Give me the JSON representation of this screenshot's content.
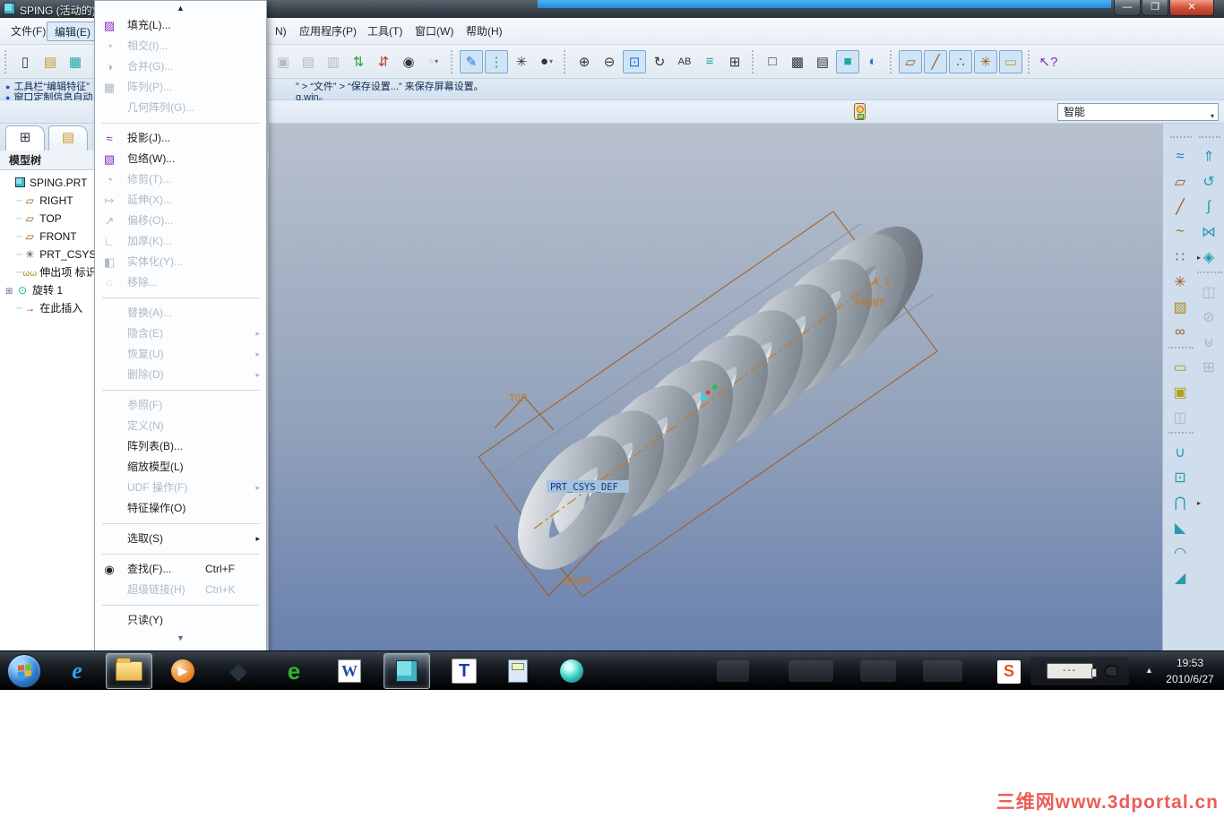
{
  "window": {
    "title": "SPING (活动的)"
  },
  "menu_bar": {
    "items": [
      "文件(F)",
      "编辑(E)",
      "N)",
      "应用程序(P)",
      "工具(T)",
      "窗口(W)",
      "帮助(H)"
    ]
  },
  "toolbar": {
    "buttons": [
      {
        "name": "new",
        "glyph": "▯"
      },
      {
        "name": "open",
        "glyph": "▤"
      },
      {
        "name": "save",
        "glyph": "▦"
      },
      {
        "name": "copy",
        "glyph": "▣",
        "disabled": true
      },
      {
        "name": "paste",
        "glyph": "▤",
        "disabled": true
      },
      {
        "name": "paste-special",
        "glyph": "▥",
        "disabled": true
      },
      {
        "name": "regenerate",
        "glyph": "⇅"
      },
      {
        "name": "regenerate-custom",
        "glyph": "⇵"
      },
      {
        "name": "find",
        "glyph": "◉"
      },
      {
        "name": "select-box",
        "glyph": "▫",
        "disabled": true,
        "dropdown": "▾"
      },
      {
        "name": "sketch-display",
        "glyph": "✎",
        "pressed": true
      },
      {
        "name": "tree-graph",
        "glyph": "⋮",
        "pressed": true
      },
      {
        "name": "view-options",
        "glyph": "✳"
      },
      {
        "name": "render-style",
        "glyph": "●",
        "dropdown": "▾"
      },
      {
        "name": "zoom-in",
        "glyph": "⊕"
      },
      {
        "name": "zoom-out",
        "glyph": "⊖"
      },
      {
        "name": "refit",
        "glyph": "⊡",
        "pressed": true
      },
      {
        "name": "reorient",
        "glyph": "↻"
      },
      {
        "name": "saved-views",
        "glyph": "AB"
      },
      {
        "name": "layers",
        "glyph": "≡"
      },
      {
        "name": "view-manager",
        "glyph": "⊞"
      },
      {
        "name": "wireframe",
        "glyph": "□"
      },
      {
        "name": "hidden-line",
        "glyph": "▩"
      },
      {
        "name": "no-hidden",
        "glyph": "▤"
      },
      {
        "name": "shaded",
        "glyph": "■",
        "pressed": true
      },
      {
        "name": "enhanced-realism",
        "glyph": "◐"
      },
      {
        "name": "plane-display",
        "glyph": "▱",
        "pressed": true
      },
      {
        "name": "axis-display",
        "glyph": "╱",
        "pressed": true
      },
      {
        "name": "point-display",
        "glyph": "∴",
        "pressed": true
      },
      {
        "name": "csys-display",
        "glyph": "✳",
        "pressed": true
      },
      {
        "name": "annotation-display",
        "glyph": "▭",
        "pressed": true
      },
      {
        "name": "context-help",
        "glyph": "↖?"
      }
    ]
  },
  "messages": {
    "line1_left": "工具栏“编辑特征”",
    "line1_right": "” > “文件” > “保存设置...” 来保存屏幕设置。",
    "line2_left": "窗口定制信息自动",
    "line2_right": "g.win。"
  },
  "filter_bar": {
    "selected": "智能",
    "arrow": "▾"
  },
  "edit_menu": {
    "scroll_up": "▲",
    "scroll_down": "▼",
    "items": [
      {
        "label": "填充(L)...",
        "glyph": "▨",
        "enabled": true
      },
      {
        "label": "相交(I)...",
        "glyph": "◔",
        "enabled": false
      },
      {
        "label": "合并(G)...",
        "glyph": "◑",
        "enabled": false
      },
      {
        "label": "阵列(P)...",
        "glyph": "▦",
        "enabled": false
      },
      {
        "label": "几何阵列(G)...",
        "enabled": false
      },
      {
        "label": "投影(J)...",
        "glyph": "≈",
        "enabled": true
      },
      {
        "label": "包络(W)...",
        "glyph": "▧",
        "enabled": true
      },
      {
        "label": "修剪(T)...",
        "glyph": "◔",
        "enabled": false
      },
      {
        "label": "延伸(X)...",
        "glyph": "↦",
        "enabled": false
      },
      {
        "label": "偏移(O)...",
        "glyph": "↗",
        "enabled": false
      },
      {
        "label": "加厚(K)...",
        "glyph": "∟",
        "enabled": false
      },
      {
        "label": "实体化(Y)...",
        "glyph": "◧",
        "enabled": false
      },
      {
        "label": "移除...",
        "glyph": "◌",
        "enabled": false
      },
      {
        "label": "替换(A)...",
        "enabled": false
      },
      {
        "label": "隐含(E)",
        "enabled": false,
        "arrow": "▸"
      },
      {
        "label": "恢复(U)",
        "enabled": false,
        "arrow": "▸"
      },
      {
        "label": "删除(D)",
        "enabled": false,
        "arrow": "▸"
      },
      {
        "label": "参照(F)",
        "enabled": false
      },
      {
        "label": "定义(N)",
        "enabled": false
      },
      {
        "label": "阵列表(B)...",
        "enabled": true
      },
      {
        "label": "缩放模型(L)",
        "enabled": true
      },
      {
        "label": "UDF 操作(F)",
        "enabled": false,
        "arrow": "▸"
      },
      {
        "label": "特征操作(O)",
        "enabled": true
      },
      {
        "label": "选取(S)",
        "enabled": true,
        "arrow": "▸"
      },
      {
        "label": "查找(F)...",
        "glyph": "◉",
        "shortcut": "Ctrl+F",
        "enabled": true
      },
      {
        "label": "超级链接(H)",
        "shortcut": "Ctrl+K",
        "enabled": false
      },
      {
        "label": "只读(Y)",
        "enabled": true
      }
    ]
  },
  "model_tree": {
    "tab1_icon": "⊞",
    "tab2_icon": "▤",
    "title": "模型树",
    "items": [
      {
        "label": "SPING.PRT",
        "icon": "part"
      },
      {
        "label": "RIGHT",
        "icon": "plane",
        "glyph": "▱"
      },
      {
        "label": "TOP",
        "icon": "plane",
        "glyph": "▱"
      },
      {
        "label": "FRONT",
        "icon": "plane",
        "glyph": "▱"
      },
      {
        "label": "PRT_CSYS_DEF",
        "icon": "csys",
        "glyph": "✳"
      },
      {
        "label": "伸出项 标识",
        "icon": "helical-sweep",
        "glyph": "ωω"
      },
      {
        "label": "旋转 1",
        "icon": "revolve",
        "glyph": "⊙",
        "expander": "⊞"
      },
      {
        "label": "在此插入",
        "icon": "insert-here",
        "glyph": "→"
      }
    ]
  },
  "graphics": {
    "labels": {
      "top": "TOP",
      "front": "FRONT",
      "axis": "A_1",
      "right": "RIGHT",
      "csys": "PRT_CSYS_DEF"
    }
  },
  "right_toolbar": {
    "col1": [
      {
        "name": "style-curve",
        "glyph": "≈",
        "color": "#2a6fc9"
      },
      {
        "name": "datum-plane",
        "glyph": "▱",
        "color": "#9a5a1e"
      },
      {
        "name": "datum-axis",
        "glyph": "╱",
        "color": "#9a5a1e"
      },
      {
        "name": "datum-curve",
        "glyph": "~",
        "color": "#9a5a1e"
      },
      {
        "name": "datum-point",
        "glyph": "∷",
        "color": "#9a5a1e",
        "fly": "▸"
      },
      {
        "name": "datum-csys",
        "glyph": "✳",
        "color": "#9a5a1e"
      },
      {
        "name": "offset-points",
        "glyph": "▨",
        "color": "#b08a20"
      },
      {
        "name": "link",
        "glyph": "∞",
        "color": "#9a5a1e"
      },
      {
        "sep": true
      },
      {
        "name": "annotation",
        "glyph": "▭",
        "color": "#b0a020"
      },
      {
        "name": "annotation-feature",
        "glyph": "▣",
        "color": "#b0a020"
      },
      {
        "name": "grouped-annotation",
        "glyph": "◫",
        "disabled": true
      },
      {
        "sep": true
      },
      {
        "name": "hole",
        "glyph": "∪",
        "color": "#2a9ab0"
      },
      {
        "name": "shell",
        "glyph": "⊡",
        "color": "#2a9ab0"
      },
      {
        "name": "rib",
        "glyph": "⋂",
        "color": "#2a9ab0",
        "fly": "▸"
      },
      {
        "name": "draft",
        "glyph": "◣",
        "color": "#2a9ab0"
      },
      {
        "name": "round",
        "glyph": "◠",
        "color": "#2a9ab0"
      },
      {
        "name": "chamfer",
        "glyph": "◢",
        "color": "#2a9ab0"
      }
    ],
    "col2": [
      {
        "name": "extrude",
        "glyph": "⇑",
        "color": "#2a9ab0"
      },
      {
        "name": "revolve",
        "glyph": "↺",
        "color": "#2a9ab0"
      },
      {
        "name": "sweep",
        "glyph": "∫",
        "color": "#2a9ab0"
      },
      {
        "name": "blend",
        "glyph": "⋈",
        "color": "#2a9ab0"
      },
      {
        "name": "boundary-blend",
        "glyph": "◈",
        "color": "#2a9ab0"
      },
      {
        "sep": true
      },
      {
        "name": "mirror",
        "glyph": "◫",
        "disabled": true
      },
      {
        "name": "trim",
        "glyph": "⊘",
        "disabled": true
      },
      {
        "name": "merge",
        "glyph": "⊎",
        "disabled": true
      },
      {
        "name": "pattern",
        "glyph": "⊞",
        "disabled": true
      }
    ]
  },
  "taskbar": {
    "time": "19:53",
    "date": "2010/6/27",
    "battery_text": "---",
    "icons": {
      "ie": "e",
      "wmp": "▶",
      "laptop": "◆",
      "browser360": "e",
      "word": "W",
      "pccad": "T",
      "tray_arrow": "▲",
      "sogou": "S"
    }
  },
  "watermark": {
    "text": "三维网www.3dportal.cn"
  },
  "colors": {
    "accent": "#2a6fc9",
    "datum_brown": "#a05a1e",
    "label_orange": "#c87820",
    "disabled": "#b0bac3"
  }
}
